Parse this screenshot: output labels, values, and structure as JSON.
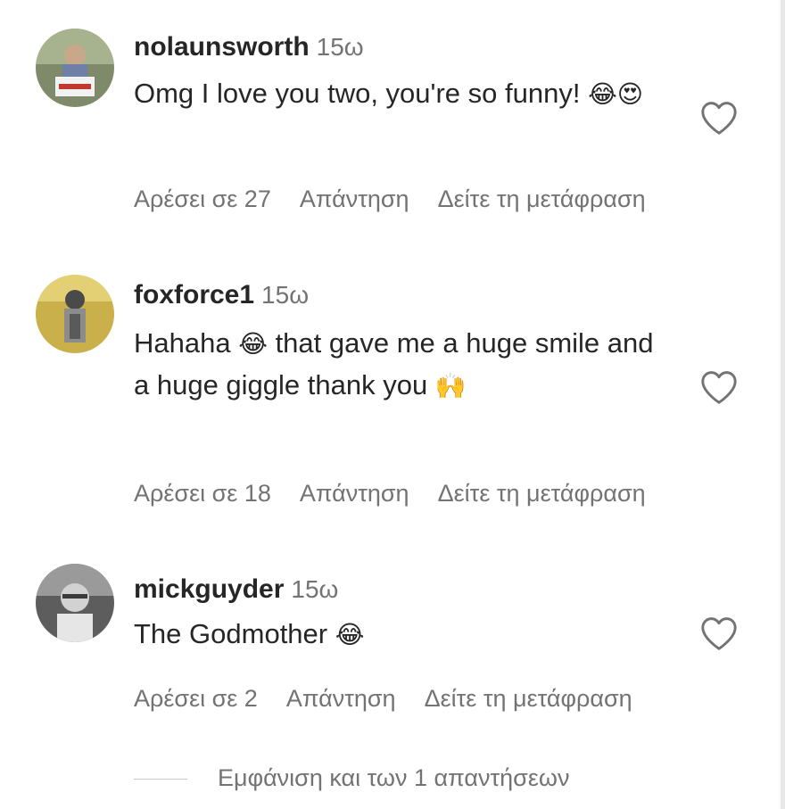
{
  "comments": [
    {
      "username": "nolaunsworth",
      "time": "15ω",
      "text": "Omg I love you two, you're so funny!",
      "emoji": "😂😍",
      "likes_label": "Αρέσει σε 27",
      "reply_label": "Απάντηση",
      "translate_label": "Δείτε τη μετάφραση"
    },
    {
      "username": "foxforce1",
      "time": "15ω",
      "text_before": "Hahaha",
      "emoji_mid": "😂",
      "text_after": "that gave me a huge smile and a huge giggle thank you",
      "emoji_end": "🙌",
      "likes_label": "Αρέσει σε 18",
      "reply_label": "Απάντηση",
      "translate_label": "Δείτε τη μετάφραση"
    },
    {
      "username": "mickguyder",
      "time": "15ω",
      "text": "The Godmother",
      "emoji": "😂",
      "likes_label": "Αρέσει σε 2",
      "reply_label": "Απάντηση",
      "translate_label": "Δείτε τη μετάφραση"
    }
  ],
  "view_replies_label": "Εμφάνιση και των 1 απαντήσεων",
  "icons": {
    "like": "heart-outline-icon"
  },
  "colors": {
    "text": "#262626",
    "secondary": "#737373",
    "divider": "#c7c7c7"
  }
}
